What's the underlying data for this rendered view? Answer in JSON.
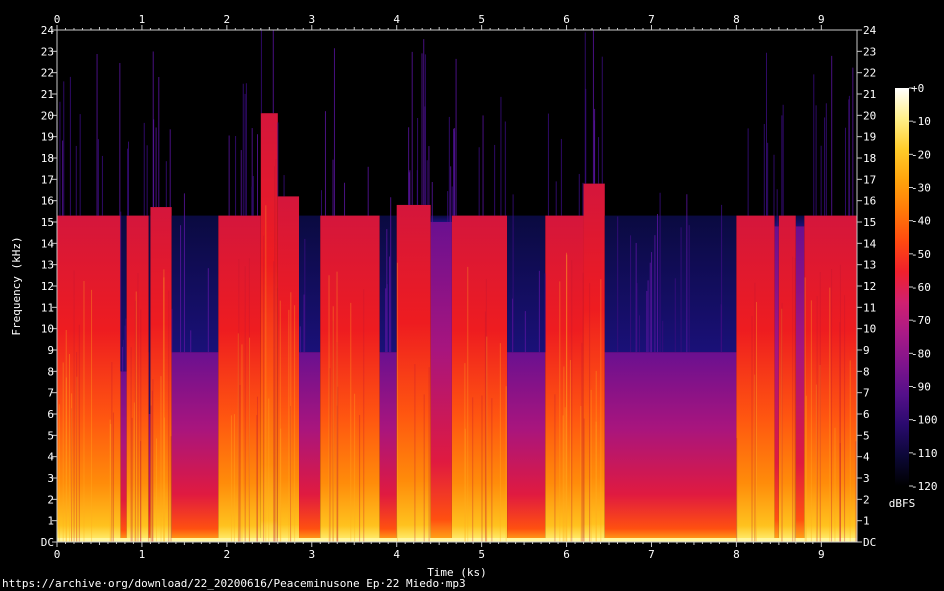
{
  "chart_data": {
    "type": "heatmap",
    "title": "",
    "xlabel": "Time (ks)",
    "ylabel": "Frequency (kHz)",
    "colorbar_label": "dBFS",
    "xlim": [
      0,
      9.42
    ],
    "ylim": [
      0,
      24
    ],
    "x_tick_labels": [
      "0",
      "1",
      "2",
      "3",
      "4",
      "5",
      "6",
      "7",
      "8",
      "9"
    ],
    "y_tick_labels": [
      "DC",
      "1",
      "2",
      "3",
      "4",
      "5",
      "6",
      "7",
      "8",
      "9",
      "10",
      "11",
      "12",
      "13",
      "14",
      "15",
      "16",
      "17",
      "18",
      "19",
      "20",
      "21",
      "22",
      "23",
      "24"
    ],
    "colorbar_range": [
      -120,
      0
    ],
    "colorbar_tick_labels": [
      "+0",
      "-10",
      "-20",
      "-30",
      "-40",
      "-50",
      "-60",
      "-70",
      "-80",
      "-90",
      "-100",
      "-110",
      "-120"
    ],
    "segments": [
      {
        "start": 0.0,
        "end": 0.75,
        "cutoff_khz": 15.3,
        "kind": "loud"
      },
      {
        "start": 0.75,
        "end": 0.82,
        "cutoff_khz": 8.0,
        "kind": "quiet"
      },
      {
        "start": 0.82,
        "end": 1.08,
        "cutoff_khz": 15.3,
        "kind": "loud"
      },
      {
        "start": 1.08,
        "end": 1.1,
        "cutoff_khz": 6.0,
        "kind": "quiet"
      },
      {
        "start": 1.1,
        "end": 1.35,
        "cutoff_khz": 15.7,
        "kind": "loud"
      },
      {
        "start": 1.35,
        "end": 1.9,
        "cutoff_khz": 8.9,
        "kind": "quiet"
      },
      {
        "start": 1.9,
        "end": 2.4,
        "cutoff_khz": 15.3,
        "kind": "loud"
      },
      {
        "start": 2.4,
        "end": 2.6,
        "cutoff_khz": 20.1,
        "kind": "loud"
      },
      {
        "start": 2.6,
        "end": 2.85,
        "cutoff_khz": 16.2,
        "kind": "loud"
      },
      {
        "start": 2.85,
        "end": 3.1,
        "cutoff_khz": 8.9,
        "kind": "quiet"
      },
      {
        "start": 3.1,
        "end": 3.8,
        "cutoff_khz": 15.3,
        "kind": "loud"
      },
      {
        "start": 3.8,
        "end": 4.0,
        "cutoff_khz": 8.9,
        "kind": "quiet"
      },
      {
        "start": 4.0,
        "end": 4.4,
        "cutoff_khz": 15.8,
        "kind": "loud"
      },
      {
        "start": 4.4,
        "end": 4.65,
        "cutoff_khz": 15.0,
        "kind": "quiet"
      },
      {
        "start": 4.65,
        "end": 5.3,
        "cutoff_khz": 15.3,
        "kind": "loud"
      },
      {
        "start": 5.3,
        "end": 5.75,
        "cutoff_khz": 8.9,
        "kind": "quiet"
      },
      {
        "start": 5.75,
        "end": 6.2,
        "cutoff_khz": 15.3,
        "kind": "loud"
      },
      {
        "start": 6.2,
        "end": 6.45,
        "cutoff_khz": 16.8,
        "kind": "loud"
      },
      {
        "start": 6.45,
        "end": 8.0,
        "cutoff_khz": 8.9,
        "kind": "quiet"
      },
      {
        "start": 8.0,
        "end": 8.45,
        "cutoff_khz": 15.3,
        "kind": "loud"
      },
      {
        "start": 8.45,
        "end": 8.5,
        "cutoff_khz": 14.8,
        "kind": "quiet"
      },
      {
        "start": 8.5,
        "end": 8.7,
        "cutoff_khz": 15.3,
        "kind": "loud"
      },
      {
        "start": 8.7,
        "end": 8.8,
        "cutoff_khz": 14.8,
        "kind": "quiet"
      },
      {
        "start": 8.8,
        "end": 9.42,
        "cutoff_khz": 15.3,
        "kind": "loud"
      }
    ],
    "colormap": [
      "#000000",
      "#0c0838",
      "#2a0a6e",
      "#55108a",
      "#80148c",
      "#aa1a86",
      "#d02070",
      "#f0202c",
      "#ff4a10",
      "#ff7a08",
      "#ffa40c",
      "#ffcc2a",
      "#fff08a",
      "#ffffff"
    ],
    "grid": false,
    "legend": "colorbar-right"
  },
  "footer": {
    "source": "https://archive·org/download/22_20200616/Peaceminusone Ep·22 Miedo·mp3"
  }
}
